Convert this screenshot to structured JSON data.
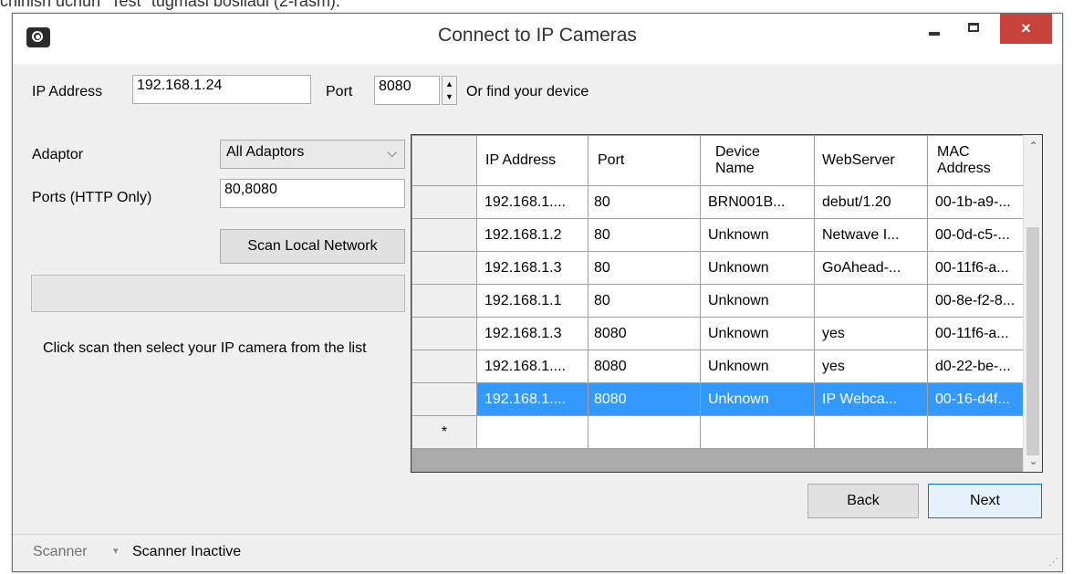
{
  "caption": "chinish uchun \"Test\" tugmasi bosiladi (2-rasm).",
  "window": {
    "title": "Connect to IP Cameras",
    "close_glyph": "×"
  },
  "form": {
    "ip_label": "IP Address",
    "ip_value": "192.168.1.24",
    "port_label": "Port",
    "port_value": "8080",
    "find_label": "Or find your device",
    "adaptor_label": "Adaptor",
    "adaptor_value": "All Adaptors",
    "ports_label": "Ports (HTTP Only)",
    "ports_value": "80,8080",
    "scan_button": "Scan Local Network",
    "hint": "Click scan then select your IP camera from the list"
  },
  "table": {
    "columns": [
      "IP Address",
      "Port",
      "Device Name",
      "WebServer",
      "MAC Address"
    ],
    "rows": [
      [
        "192.168.1....",
        "80",
        "BRN001B...",
        "debut/1.20",
        "00-1b-a9-..."
      ],
      [
        "192.168.1.2",
        "80",
        "Unknown",
        "Netwave I...",
        "00-0d-c5-..."
      ],
      [
        "192.168.1.3",
        "80",
        "Unknown",
        "GoAhead-...",
        "00-11f6-a..."
      ],
      [
        "192.168.1.1",
        "80",
        "Unknown",
        "",
        "00-8e-f2-8..."
      ],
      [
        "192.168.1.3",
        "8080",
        "Unknown",
        "yes",
        "00-11f6-a..."
      ],
      [
        "192.168.1....",
        "8080",
        "Unknown",
        "yes",
        "d0-22-be-..."
      ],
      [
        "192.168.1....",
        "8080",
        "Unknown",
        "IP Webca...",
        "00-16-d4f..."
      ]
    ],
    "selected_row": 6,
    "new_row_marker": "*"
  },
  "buttons": {
    "back": "Back",
    "next": "Next"
  },
  "status": {
    "left": "Scanner",
    "text": "Scanner Inactive"
  },
  "colors": {
    "selection": "#3399ff",
    "close": "#c7423b"
  }
}
